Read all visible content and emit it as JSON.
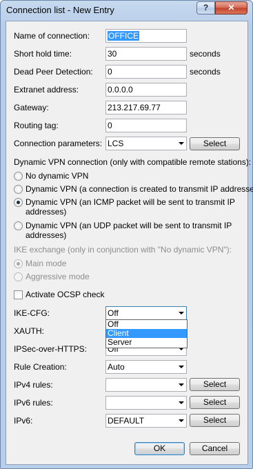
{
  "window": {
    "title": "Connection list - New Entry",
    "help_label": "?",
    "close_label": "✕"
  },
  "fields": {
    "name": {
      "label": "Name of connection:",
      "value": "OFFICE"
    },
    "hold_time": {
      "label": "Short hold time:",
      "value": "30",
      "unit": "seconds"
    },
    "dpd": {
      "label": "Dead Peer Detection:",
      "value": "0",
      "unit": "seconds"
    },
    "extranet": {
      "label": "Extranet address:",
      "value": "0.0.0.0"
    },
    "gateway": {
      "label": "Gateway:",
      "value": "213.217.69.77"
    },
    "routing_tag": {
      "label": "Routing tag:",
      "value": "0"
    },
    "conn_params": {
      "label": "Connection parameters:",
      "value": "LCS",
      "button": "Select"
    }
  },
  "dynamic_vpn": {
    "heading": "Dynamic VPN connection (only with compatible remote stations):",
    "options": [
      {
        "label": "No dynamic VPN",
        "selected": false
      },
      {
        "label": "Dynamic VPN (a connection is created to transmit IP addresses)",
        "selected": false
      },
      {
        "label_line1": "Dynamic VPN (an ICMP packet will be sent to transmit IP",
        "label_line2": "addresses)",
        "selected": true
      },
      {
        "label_line1": "Dynamic VPN (an UDP packet will be sent to transmit IP",
        "label_line2": "addresses)",
        "selected": false
      }
    ]
  },
  "ike_exchange": {
    "heading": "IKE exchange (only in conjunction with \"No dynamic VPN\"):",
    "options": [
      {
        "label": "Main mode",
        "selected": true
      },
      {
        "label": "Aggressive mode",
        "selected": false
      }
    ]
  },
  "ocsp": {
    "label": "Activate OCSP check",
    "checked": false
  },
  "ike_cfg": {
    "label": "IKE-CFG:",
    "value": "Off",
    "dropdown_open": true,
    "options": [
      "Off",
      "Client",
      "Server"
    ],
    "highlighted": "Client"
  },
  "xauth": {
    "label": "XAUTH:"
  },
  "ipsec_https": {
    "label": "IPSec-over-HTTPS:",
    "value": "Off"
  },
  "rule_creation": {
    "label": "Rule Creation:",
    "value": "Auto"
  },
  "ipv4_rules": {
    "label": "IPv4 rules:",
    "value": "",
    "button": "Select"
  },
  "ipv6_rules": {
    "label": "IPv6 rules:",
    "value": "",
    "button": "Select"
  },
  "ipv6": {
    "label": "IPv6:",
    "value": "DEFAULT",
    "button": "Select"
  },
  "footer": {
    "ok_label": "OK",
    "cancel_label": "Cancel"
  }
}
